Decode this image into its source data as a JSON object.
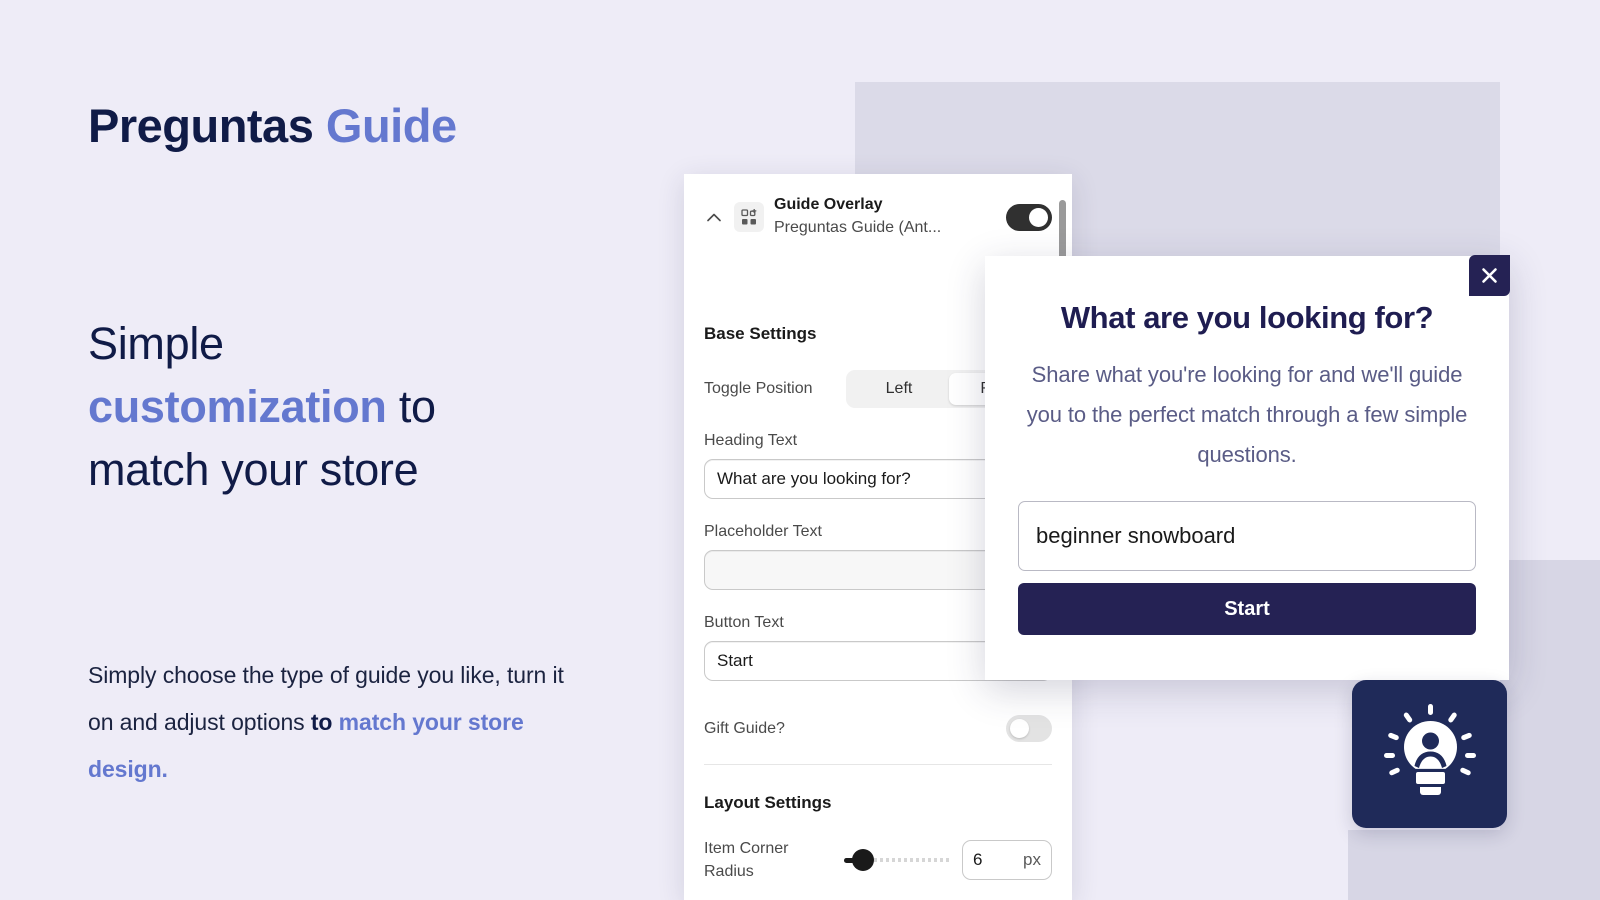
{
  "hero": {
    "brand_name": "Preguntas",
    "brand_suffix": "Guide",
    "headline_line1": "Simple",
    "headline_accent": "customization",
    "headline_line2_tail": " to",
    "headline_line3": "match your store",
    "body_part1": "Simply choose the type of guide you like, turn it on and adjust options ",
    "body_bold_dark": "to",
    "body_bold_accent": "match your store design",
    "body_period": "."
  },
  "settings_panel": {
    "header": {
      "title": "Guide Overlay",
      "subtitle": "Preguntas Guide (Ant...",
      "collapse_icon": "chevron-up-icon",
      "block_icon": "app-block-icon",
      "enabled_toggle": "on"
    },
    "sections": [
      {
        "title": "Base Settings"
      },
      {
        "title": "Layout Settings"
      }
    ],
    "base_settings": {
      "title": "Base Settings",
      "toggle_position": {
        "label": "Toggle Position",
        "options": [
          "Left",
          "Right"
        ],
        "selected": "Right"
      },
      "heading_text": {
        "label": "Heading Text",
        "value": "What are you looking for?"
      },
      "placeholder_text": {
        "label": "Placeholder Text",
        "value": ""
      },
      "button_text": {
        "label": "Button Text",
        "value": "Start"
      },
      "gift_guide": {
        "label": "Gift Guide?",
        "state": "off"
      }
    },
    "layout_settings": {
      "title": "Layout Settings",
      "item_corner_radius": {
        "label": "Item Corner Radius",
        "value": "6",
        "unit": "px"
      }
    }
  },
  "modal_preview": {
    "close_icon": "close-icon",
    "heading": "What are you looking for?",
    "subtext": "Share what you're looking for and we'll guide you to the perfect match through a few simple questions.",
    "input_value": "beginner snowboard",
    "input_placeholder": "",
    "button_label": "Start"
  },
  "launcher": {
    "icon": "lightbulb-person-icon"
  },
  "colors": {
    "page_background": "#eeecf7",
    "accent_blue": "#6478cf",
    "navy": "#101b47",
    "modal_navy": "#252254",
    "launcher_navy": "#1f2a59",
    "bg_shape_grey": "#dbdae8"
  }
}
